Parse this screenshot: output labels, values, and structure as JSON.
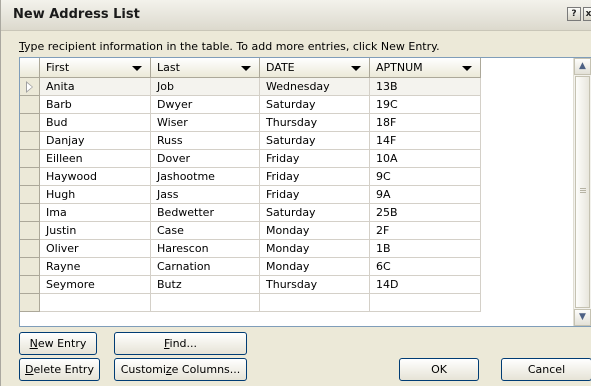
{
  "dialog": {
    "title": "New Address List",
    "help_button": "?",
    "close_button": "x"
  },
  "instructions": {
    "mnemonic": "T",
    "text": "ype recipient information in the table.  To add more entries, click New Entry."
  },
  "columns": [
    "First",
    "Last",
    "DATE",
    "APTNUM"
  ],
  "rows": [
    {
      "first": "Anita",
      "last": "Job",
      "date": "Wednesday",
      "aptnum": "13B"
    },
    {
      "first": "Barb",
      "last": "Dwyer",
      "date": "Saturday",
      "aptnum": "19C"
    },
    {
      "first": "Bud",
      "last": "Wiser",
      "date": "Thursday",
      "aptnum": "18F"
    },
    {
      "first": "Danjay",
      "last": "Russ",
      "date": "Saturday",
      "aptnum": "14F"
    },
    {
      "first": "Eilleen",
      "last": "Dover",
      "date": "Friday",
      "aptnum": "10A"
    },
    {
      "first": "Haywood",
      "last": "Jashootme",
      "date": "Friday",
      "aptnum": "9C"
    },
    {
      "first": "Hugh",
      "last": "Jass",
      "date": "Friday",
      "aptnum": "9A"
    },
    {
      "first": "Ima",
      "last": "Bedwetter",
      "date": "Saturday",
      "aptnum": "25B"
    },
    {
      "first": "Justin",
      "last": "Case",
      "date": "Monday",
      "aptnum": "2F"
    },
    {
      "first": "Oliver",
      "last": "Harescon",
      "date": "Monday",
      "aptnum": "1B"
    },
    {
      "first": "Rayne",
      "last": "Carnation",
      "date": "Monday",
      "aptnum": "6C"
    },
    {
      "first": "Seymore",
      "last": "Butz",
      "date": "Thursday",
      "aptnum": "14D"
    },
    {
      "first": "",
      "last": "",
      "date": "",
      "aptnum": ""
    }
  ],
  "buttons": {
    "new_entry": {
      "mnemonic": "N",
      "rest": "ew Entry"
    },
    "find": {
      "mnemonic": "F",
      "rest": "ind..."
    },
    "delete_entry": {
      "mnemonic": "D",
      "rest": "elete Entry"
    },
    "customize_columns": {
      "pre": "Customi",
      "mnemonic": "z",
      "rest": "e Columns..."
    },
    "ok": "OK",
    "cancel": "Cancel"
  },
  "colors": {
    "dialog_bg": "#ece9d8",
    "button_border": "#003c74",
    "grid_border": "#7f9db9"
  }
}
